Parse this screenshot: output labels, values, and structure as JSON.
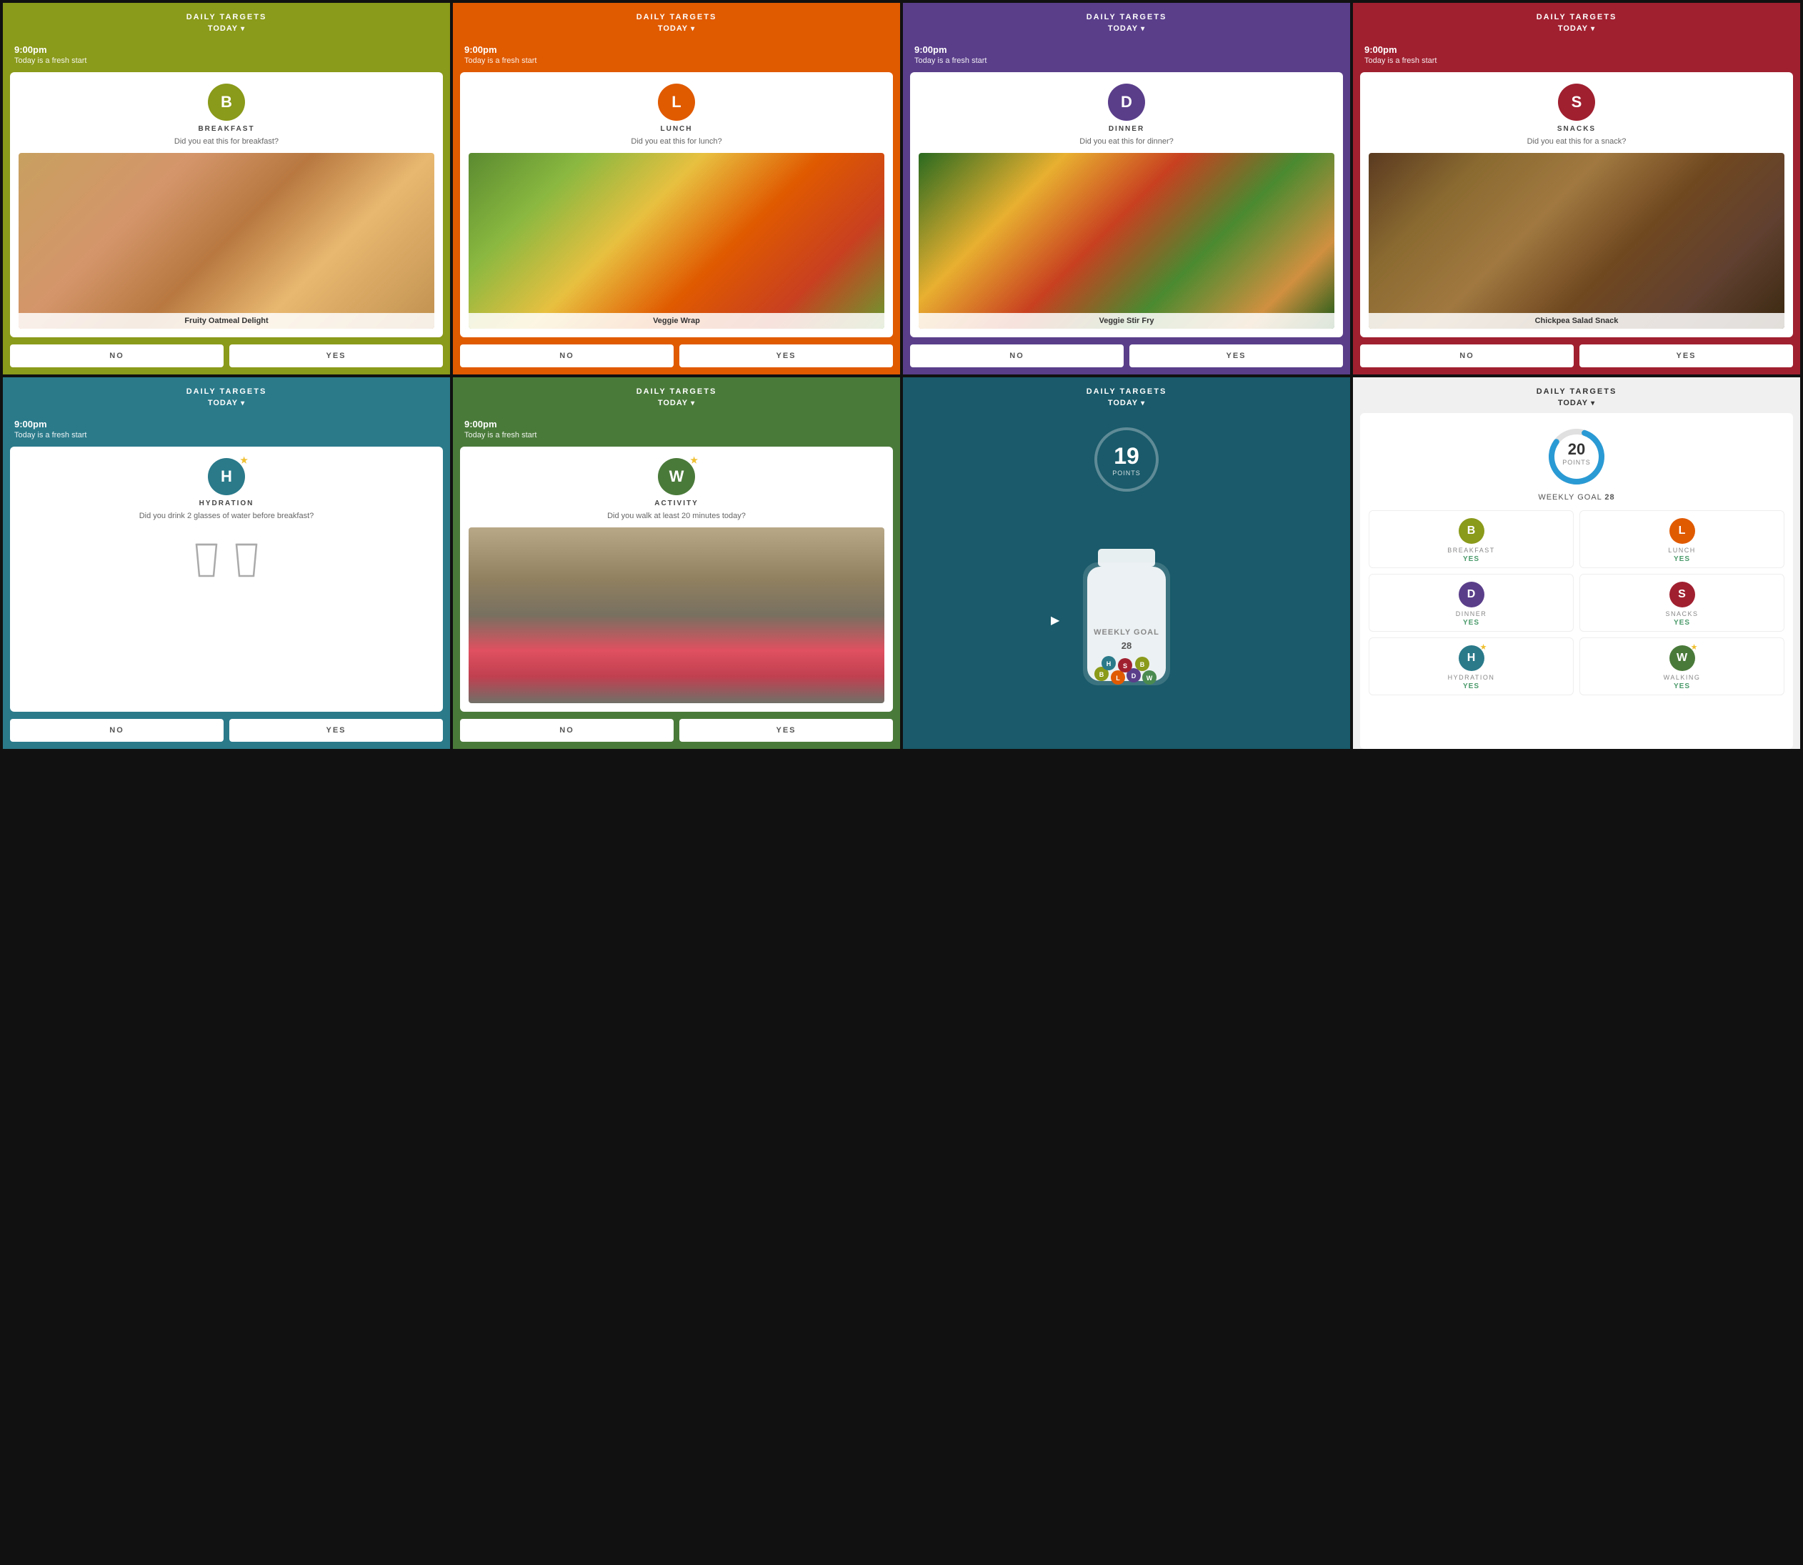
{
  "app": {
    "title": "DAILY TARGETS",
    "today_label": "TODAY",
    "time": "9:00pm",
    "fresh_start": "Today is a fresh start",
    "no_label": "NO",
    "yes_label": "YES"
  },
  "cards": [
    {
      "id": "breakfast",
      "theme": "olive",
      "icon_letter": "B",
      "icon_color": "olive",
      "meal_type": "BREAKFAST",
      "question": "Did you eat this for breakfast?",
      "food_name": "Fruity Oatmeal Delight",
      "food_style": "oatmeal"
    },
    {
      "id": "lunch",
      "theme": "orange",
      "icon_letter": "L",
      "icon_color": "orange",
      "meal_type": "LUNCH",
      "question": "Did you eat this for lunch?",
      "food_name": "Veggie Wrap",
      "food_style": "veggie-wrap"
    },
    {
      "id": "dinner",
      "theme": "purple",
      "icon_letter": "D",
      "icon_color": "purple",
      "meal_type": "DINNER",
      "question": "Did you eat this for dinner?",
      "food_name": "Veggie Stir Fry",
      "food_style": "stir-fry"
    },
    {
      "id": "snacks",
      "theme": "red",
      "icon_letter": "S",
      "icon_color": "red",
      "meal_type": "SNACKS",
      "question": "Did you eat this for a snack?",
      "food_name": "Chickpea Salad Snack",
      "food_style": "chickpea"
    },
    {
      "id": "hydration",
      "theme": "teal",
      "icon_letter": "H",
      "icon_color": "teal",
      "meal_type": "HYDRATION",
      "question": "Did you drink 2 glasses of water before breakfast?",
      "has_image": false
    },
    {
      "id": "activity",
      "theme": "green",
      "icon_letter": "W",
      "icon_color": "green",
      "meal_type": "ACTIVITY",
      "question": "Did you walk at least 20 minutes today?",
      "food_name": "",
      "food_style": "walking"
    },
    {
      "id": "points",
      "theme": "dark-teal",
      "points": 19,
      "points_label": "POINTS",
      "weekly_goal_label": "WEEKLY GOAL",
      "weekly_goal_value": 28
    },
    {
      "id": "summary",
      "theme": "light-gray",
      "points": 20,
      "points_label": "POINTS",
      "weekly_goal_label": "WEEKLY GOAL",
      "weekly_goal_value": 28,
      "items": [
        {
          "letter": "B",
          "color": "olive",
          "label": "BREAKFAST",
          "status": "YES",
          "has_star": false
        },
        {
          "letter": "L",
          "color": "orange",
          "label": "LUNCH",
          "status": "YES",
          "has_star": false
        },
        {
          "letter": "D",
          "color": "purple",
          "label": "DINNER",
          "status": "YES",
          "has_star": false
        },
        {
          "letter": "S",
          "color": "red",
          "label": "SNACKS",
          "status": "YES",
          "has_star": false
        },
        {
          "letter": "H",
          "color": "teal",
          "label": "HYDRATION",
          "status": "YES",
          "has_star": true
        },
        {
          "letter": "W",
          "color": "green",
          "label": "WALKING",
          "status": "YES",
          "has_star": true
        }
      ]
    }
  ]
}
